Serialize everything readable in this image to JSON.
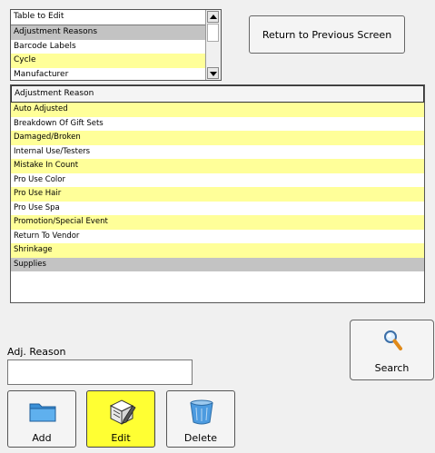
{
  "table_list": {
    "header": "Table to Edit",
    "items": [
      {
        "label": "Adjustment Reasons",
        "style": "sel"
      },
      {
        "label": "Barcode Labels",
        "style": "wht"
      },
      {
        "label": "Cycle",
        "style": "yel"
      },
      {
        "label": "Manufacturer",
        "style": "wht"
      }
    ]
  },
  "return_button": "Return to Previous Screen",
  "reason_list": {
    "header": "Adjustment Reason",
    "items": [
      {
        "label": "Auto Adjusted",
        "style": "yel"
      },
      {
        "label": "Breakdown Of Gift Sets",
        "style": "wht"
      },
      {
        "label": "Damaged/Broken",
        "style": "yel"
      },
      {
        "label": "Internal Use/Testers",
        "style": "wht"
      },
      {
        "label": "Mistake In Count",
        "style": "yel"
      },
      {
        "label": "Pro Use Color",
        "style": "wht"
      },
      {
        "label": "Pro Use Hair",
        "style": "yel"
      },
      {
        "label": "Pro Use Spa",
        "style": "wht"
      },
      {
        "label": "Promotion/Special Event",
        "style": "yel"
      },
      {
        "label": "Return To Vendor",
        "style": "wht"
      },
      {
        "label": "Shrinkage",
        "style": "yel"
      },
      {
        "label": "Supplies",
        "style": "sel"
      }
    ]
  },
  "search_button": {
    "label": "Search",
    "icon": "magnifier-icon"
  },
  "adj_reason": {
    "label": "Adj. Reason",
    "value": ""
  },
  "actions": {
    "add": {
      "label": "Add",
      "icon": "folder-icon"
    },
    "edit": {
      "label": "Edit",
      "icon": "edit-icon"
    },
    "delete": {
      "label": "Delete",
      "icon": "recycle-bin-icon"
    }
  },
  "colors": {
    "row_yellow": "#ffff99",
    "row_selected": "#c3c3c3",
    "edit_button": "#ffff33"
  }
}
